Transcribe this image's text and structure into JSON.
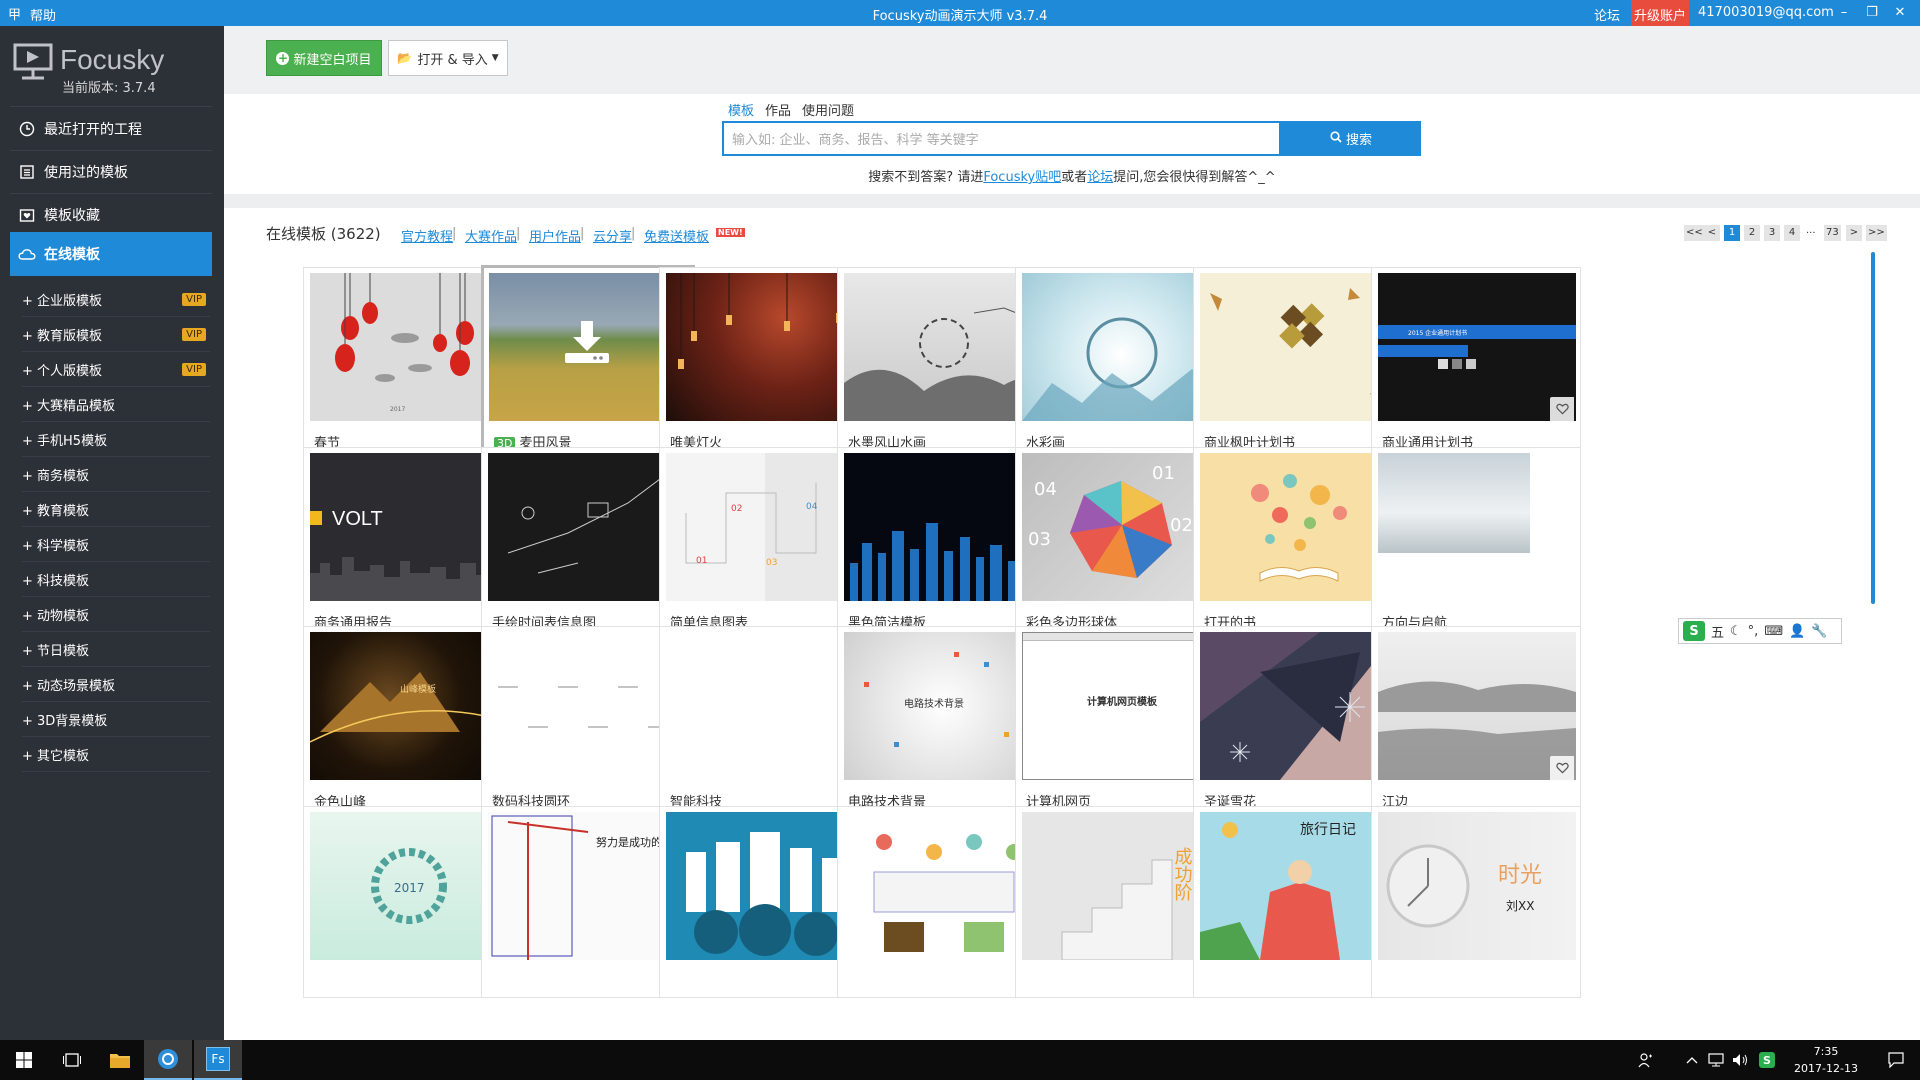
{
  "titlebar": {
    "help": "帮助",
    "title": "Focusky动画演示大师 v3.7.4",
    "forum": "论坛",
    "upgrade": "升级账户",
    "account": "417003019@qq.com"
  },
  "sidebar": {
    "logo_text": "Focusky",
    "version": "当前版本: 3.7.4",
    "main_items": [
      {
        "label": "最近打开的工程",
        "icon": "clock-icon"
      },
      {
        "label": "使用过的模板",
        "icon": "list-icon"
      },
      {
        "label": "模板收藏",
        "icon": "favorites-icon"
      },
      {
        "label": "在线模板",
        "icon": "cloud-icon"
      }
    ],
    "sub_items": [
      {
        "label": "+ 企业版模板",
        "vip": "VIP"
      },
      {
        "label": "+ 教育版模板",
        "vip": "VIP"
      },
      {
        "label": "+ 个人版模板",
        "vip": "VIP"
      },
      {
        "label": "+ 大赛精品模板"
      },
      {
        "label": "+ 手机H5模板"
      },
      {
        "label": "+ 商务模板"
      },
      {
        "label": "+ 教育模板"
      },
      {
        "label": "+ 科学模板"
      },
      {
        "label": "+ 科技模板"
      },
      {
        "label": "+ 动物模板"
      },
      {
        "label": "+ 节日模板"
      },
      {
        "label": "+ 动态场景模板"
      },
      {
        "label": "+ 3D背景模板"
      },
      {
        "label": "+ 其它模板"
      }
    ]
  },
  "toolbar": {
    "new_project": "新建空白项目",
    "open_import": "打开 & 导入"
  },
  "search": {
    "tabs": [
      "模板",
      "作品",
      "使用问题"
    ],
    "placeholder": "输入如: 企业、商务、报告、科学 等关键字",
    "button": "搜索",
    "hint_prefix": "搜索不到答案? 请进",
    "hint_link1": "Focusky贴吧",
    "hint_mid": "或者",
    "hint_link2": "论坛",
    "hint_suffix": "提问,您会很快得到解答^_^"
  },
  "gallery": {
    "title": "在线模板 (3622)",
    "links": [
      "官方教程",
      "大赛作品",
      "用户作品",
      "云分享",
      "免费送模板"
    ],
    "new_badge": "NEW!",
    "pagination": [
      "<<",
      "<",
      "1",
      "2",
      "3",
      "4",
      "...",
      "73",
      ">",
      ">>"
    ],
    "cards": [
      {
        "label": "春节",
        "tag": ""
      },
      {
        "label": "麦田风景",
        "tag": "3D"
      },
      {
        "label": "唯美灯火",
        "tag": ""
      },
      {
        "label": "水墨风山水画",
        "tag": ""
      },
      {
        "label": "水彩画",
        "tag": ""
      },
      {
        "label": "商业枫叶计划书",
        "tag": ""
      },
      {
        "label": "商业通用计划书",
        "tag": ""
      },
      {
        "label": "商务通用报告",
        "tag": ""
      },
      {
        "label": "手绘时间表信息图",
        "tag": ""
      },
      {
        "label": "简单信息图表",
        "tag": ""
      },
      {
        "label": "黑色简洁模板",
        "tag": ""
      },
      {
        "label": "彩色多边形球体",
        "tag": ""
      },
      {
        "label": "打开的书",
        "tag": ""
      },
      {
        "label": "方向与启航",
        "tag": ""
      },
      {
        "label": "金色山峰",
        "tag": ""
      },
      {
        "label": "数码科技圆环",
        "tag": ""
      },
      {
        "label": "智能科技",
        "tag": ""
      },
      {
        "label": "电路技术背景",
        "tag": ""
      },
      {
        "label": "计算机网页",
        "tag": ""
      },
      {
        "label": "圣诞雪花",
        "tag": ""
      },
      {
        "label": "江边",
        "tag": ""
      },
      {
        "label": "",
        "tag": ""
      },
      {
        "label": "",
        "tag": ""
      },
      {
        "label": "",
        "tag": ""
      },
      {
        "label": "",
        "tag": ""
      },
      {
        "label": "",
        "tag": ""
      },
      {
        "label": "",
        "tag": ""
      },
      {
        "label": "",
        "tag": ""
      }
    ],
    "thumb_texts": {
      "spring_year": "2017",
      "volt": "VOLT",
      "info_02": "02",
      "info_04": "04",
      "info_01": "01",
      "info_03": "03",
      "poly_01": "01",
      "poly_02": "02",
      "poly_03": "03",
      "poly_04": "04",
      "mountain": "山峰模板",
      "circuit": "电路技术背景",
      "web": "计算机网页模板",
      "wreath_year": "2017",
      "effort": "努力是成功的钥匙",
      "success": "成功阶",
      "travel": "旅行日记",
      "time": "时光",
      "time_name": "刘XX",
      "plan_title": "2015 企业通用计划书"
    }
  },
  "ime": {
    "label": "五"
  },
  "taskbar": {
    "time": "7:35",
    "date": "2017-12-13"
  }
}
